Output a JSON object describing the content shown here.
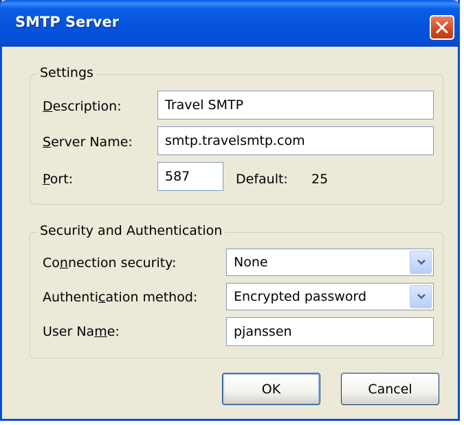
{
  "window": {
    "title": "SMTP Server"
  },
  "settings": {
    "legend": "Settings",
    "description_label_mnemonic": "D",
    "description_label_rest": "escription:",
    "description_value": "Travel SMTP",
    "server_label_mnemonic": "S",
    "server_label_rest": "erver Name:",
    "server_value": "smtp.travelsmtp.com",
    "port_label_mnemonic": "P",
    "port_label_rest": "ort:",
    "port_value": "587",
    "default_label": "Default:",
    "default_value": "25"
  },
  "security": {
    "legend": "Security and Authentication",
    "connection_label_pre": "Co",
    "connection_label_mnemonic": "n",
    "connection_label_post": "nection security:",
    "connection_value": "None",
    "auth_label_pre": "Authenti",
    "auth_label_mnemonic": "c",
    "auth_label_post": "ation method:",
    "auth_value": "Encrypted password",
    "user_label_pre": "User Na",
    "user_label_mnemonic": "m",
    "user_label_post": "e:",
    "user_value": "pjanssen"
  },
  "buttons": {
    "ok": "OK",
    "cancel": "Cancel"
  },
  "icons": {
    "close": "close-icon",
    "dropdown": "chevron-down-icon"
  },
  "colors": {
    "titlebar": "#0654dc",
    "dialog_bg": "#ece9d8",
    "close": "#d24a1f"
  }
}
